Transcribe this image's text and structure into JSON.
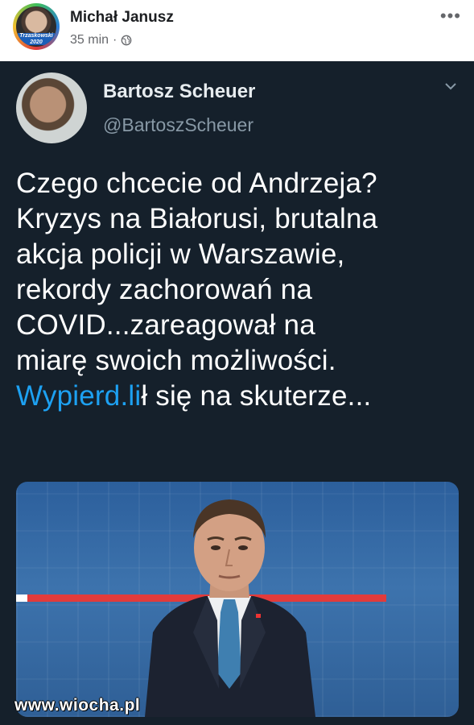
{
  "post": {
    "author": "Michał Janusz",
    "time": "35 min",
    "separator": "·",
    "avatar_badge": "Trzaskowski 2020",
    "more_icon": "ellipsis-icon",
    "audience_icon": "globe-icon"
  },
  "tweet": {
    "name": "Bartosz Scheuer",
    "handle": "@BartoszScheuer",
    "lines": [
      "Czego chcecie od Andrzeja?",
      "Kryzys na Białorusi, brutalna",
      "akcja policji w Warszawie,",
      "rekordy zachorowań na",
      "COVID...zareagował na",
      "miarę swoich możliwości."
    ],
    "last_line_link": "Wypierd.li",
    "last_line_rest": "ł się na skuterze...",
    "colors": {
      "background": "#15202b",
      "link": "#1da1f2",
      "accent_stripe": "#e23b3b"
    }
  },
  "watermark": "www.wiocha.pl"
}
